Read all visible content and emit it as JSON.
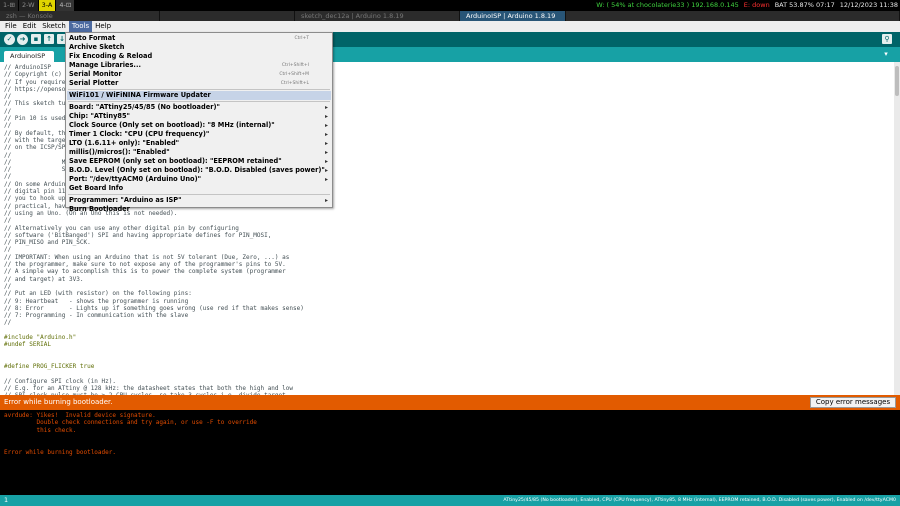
{
  "topbar": {
    "workspaces": [
      {
        "label": "1-⊞",
        "state": "normal"
      },
      {
        "label": "2-W",
        "state": "normal"
      },
      {
        "label": "3-A",
        "state": "active"
      },
      {
        "label": "4-⊡",
        "state": "urgent"
      }
    ],
    "wifi": "W: ( 54% at chocolaterie33 ) 192.168.0.145",
    "ethernet": "E: down",
    "battery": "BAT 53.87% 07:17",
    "datetime": "12/12/2023 11:38"
  },
  "titlebar": {
    "tabs": [
      "zsh — Konsole",
      "sketch_dec12a | Arduino 1.8.19",
      "ArduinoISP | Arduino 1.8.19"
    ],
    "focused_index": 2
  },
  "menubar": {
    "items": [
      "File",
      "Edit",
      "Sketch",
      "Tools",
      "Help"
    ],
    "open_index": 3
  },
  "toolbar": {
    "verify_icon": "check-icon",
    "upload_icon": "arrow-right-icon",
    "new_icon": "new-file-icon",
    "open_icon": "open-icon",
    "save_icon": "save-icon",
    "serial_monitor_icon": "magnifier-icon"
  },
  "tabs": {
    "active": "ArduinoISP",
    "menu_icon": "triangle-down-icon"
  },
  "tools_menu": {
    "items": [
      {
        "label": "Auto Format",
        "shortcut": "Ctrl+T",
        "submenu": false
      },
      {
        "label": "Archive Sketch",
        "shortcut": "",
        "submenu": false
      },
      {
        "label": "Fix Encoding & Reload",
        "shortcut": "",
        "submenu": false
      },
      {
        "label": "Manage Libraries...",
        "shortcut": "Ctrl+Shift+I",
        "submenu": false
      },
      {
        "label": "Serial Monitor",
        "shortcut": "Ctrl+Shift+M",
        "submenu": false
      },
      {
        "label": "Serial Plotter",
        "shortcut": "Ctrl+Shift+L",
        "submenu": false
      },
      {
        "separator": true
      },
      {
        "label": "WiFi101 / WiFiNINA Firmware Updater",
        "shortcut": "",
        "submenu": false,
        "highlighted": true
      },
      {
        "separator": true
      },
      {
        "label": "Board: \"ATtiny25/45/85 (No bootloader)\"",
        "shortcut": "",
        "submenu": true
      },
      {
        "label": "Chip: \"ATtiny85\"",
        "shortcut": "",
        "submenu": true
      },
      {
        "label": "Clock Source (Only set on bootload): \"8 MHz (internal)\"",
        "shortcut": "",
        "submenu": true
      },
      {
        "label": "Timer 1 Clock: \"CPU (CPU frequency)\"",
        "shortcut": "",
        "submenu": true
      },
      {
        "label": "LTO (1.6.11+ only): \"Enabled\"",
        "shortcut": "",
        "submenu": true
      },
      {
        "label": "millis()/micros(): \"Enabled\"",
        "shortcut": "",
        "submenu": true
      },
      {
        "label": "Save EEPROM (only set on bootload): \"EEPROM retained\"",
        "shortcut": "",
        "submenu": true
      },
      {
        "label": "B.O.D. Level (Only set on bootload): \"B.O.D. Disabled (saves power)\"",
        "shortcut": "",
        "submenu": true
      },
      {
        "label": "Port: \"/dev/ttyACM0 (Arduino Uno)\"",
        "shortcut": "",
        "submenu": true
      },
      {
        "label": "Get Board Info",
        "shortcut": "",
        "submenu": false
      },
      {
        "separator": true
      },
      {
        "label": "Programmer: \"Arduino as ISP\"",
        "shortcut": "",
        "submenu": true
      },
      {
        "label": "Burn Bootloader",
        "shortcut": "",
        "submenu": false
      }
    ]
  },
  "editor": {
    "lines": [
      "// ArduinoISP",
      "// Copyright (c) 20",
      "// If you require a",
      "// https://opensour",
      "//",
      "// This sketch turn",
      "//",
      "// Pin 10 is used t",
      "//",
      "// By default, the",
      "// with the target.",
      "// on the ICSP/SPI",
      "//",
      "//              MI",
      "//              SC",
      "//",
      "// On some Arduinos",
      "// digital pin 11,",
      "// you to hook up t",
      "// practical, have",
      "// using an Uno. (On an Uno this is not needed).",
      "//",
      "// Alternatively you can use any other digital pin by configuring",
      "// software ('BitBanged') SPI and having appropriate defines for PIN_MOSI,",
      "// PIN_MISO and PIN_SCK.",
      "//",
      "// IMPORTANT: When using an Arduino that is not 5V tolerant (Due, Zero, ...) as",
      "// the programmer, make sure to not expose any of the programmer's pins to 5V.",
      "// A simple way to accomplish this is to power the complete system (programmer",
      "// and target) at 3V3.",
      "//",
      "// Put an LED (with resistor) on the following pins:",
      "// 9: Heartbeat   - shows the programmer is running",
      "// 8: Error       - Lights up if something goes wrong (use red if that makes sense)",
      "// 7: Programming - In communication with the slave",
      "//",
      "",
      "#include \"Arduino.h\"",
      "#undef SERIAL",
      "",
      "",
      "#define PROG_FLICKER true",
      "",
      "// Configure SPI clock (in Hz).",
      "// E.g. for an ATtiny @ 128 kHz: the datasheet states that both the high and low",
      "// SPI clock pulse must be > 2 CPU cycles, so take 3 cycles i.e. divide target"
    ]
  },
  "status": {
    "message": "Error while burning bootloader.",
    "copy_button": "Copy error messages"
  },
  "console": {
    "lines": [
      "avrdude: Yikes!  Invalid device signature.",
      "         Double check connections and try again, or use -F to override",
      "         this check.",
      "",
      "",
      "Error while burning bootloader."
    ]
  },
  "bottombar": {
    "line_number": "1",
    "board_info": "ATtiny25/45/85 (No bootloader), Enabled, CPU (CPU frequency), ATtiny85, 8 MHz (internal), EEPROM retained, B.O.D. Disabled (saves power), Enabled on /dev/ttyACM0"
  },
  "colors": {
    "toolbar": "#006468",
    "tabbar": "#17a1a5",
    "status_error": "#e25b00",
    "console_text": "#e34c00",
    "menu_highlight": "#c6d3e7"
  }
}
